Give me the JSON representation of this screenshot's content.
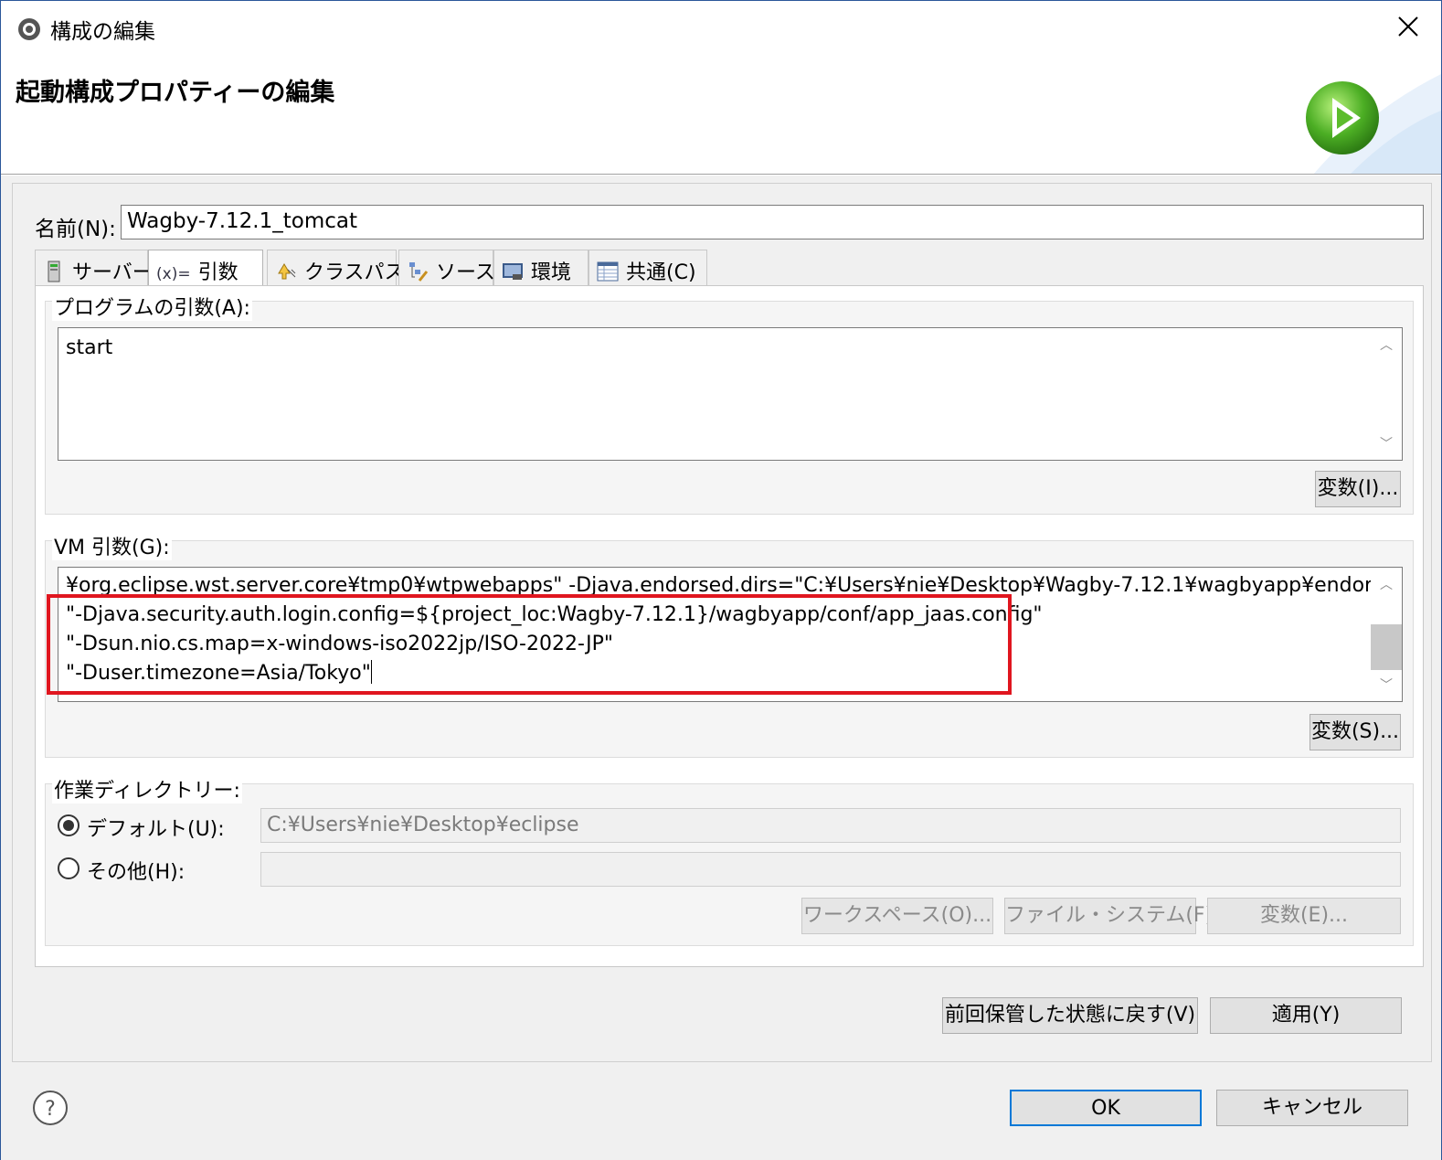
{
  "window": {
    "title": "構成の編集",
    "header_title": "起動構成プロパティーの編集"
  },
  "name": {
    "label": "名前(N):",
    "value": "Wagby-7.12.1_tomcat"
  },
  "tabs": [
    {
      "label": "サーバー",
      "icon": "server-icon"
    },
    {
      "label": "引数",
      "prefix": "(x)=",
      "icon": "arguments-icon"
    },
    {
      "label": "クラスパス",
      "icon": "classpath-icon"
    },
    {
      "label": "ソース",
      "icon": "source-icon"
    },
    {
      "label": "環境",
      "icon": "environment-icon"
    },
    {
      "label": "共通(C)",
      "icon": "common-icon"
    }
  ],
  "program_args": {
    "label": "プログラムの引数(A):",
    "value": "start",
    "variables_button": "変数(I)..."
  },
  "vm_args": {
    "label": "VM 引数(G):",
    "lines": [
      "¥org.eclipse.wst.server.core¥tmp0¥wtpwebapps\" -Djava.endorsed.dirs=\"C:¥Users¥nie¥Desktop¥Wagby-7.12.1¥wagbyapp¥endorsed\"",
      "\"-Djava.security.auth.login.config=${project_loc:Wagby-7.12.1}/wagbyapp/conf/app_jaas.config\"",
      "\"-Dsun.nio.cs.map=x-windows-iso2022jp/ISO-2022-JP\"",
      "\"-Duser.timezone=Asia/Tokyo\""
    ],
    "variables_button": "変数(S)..."
  },
  "working_dir": {
    "label": "作業ディレクトリー:",
    "default_label": "デフォルト(U):",
    "default_value": "C:¥Users¥nie¥Desktop¥eclipse",
    "other_label": "その他(H):",
    "other_value": "",
    "workspace_button": "ワークスペース(O)...",
    "filesystem_button": "ファイル・システム(F)...",
    "variables_button": "変数(E)..."
  },
  "buttons": {
    "revert": "前回保管した状態に戻す(V)",
    "apply": "適用(Y)",
    "ok": "OK",
    "cancel": "キャンセル"
  },
  "colors": {
    "highlight": "#e0161f",
    "accent": "#0078d7"
  }
}
